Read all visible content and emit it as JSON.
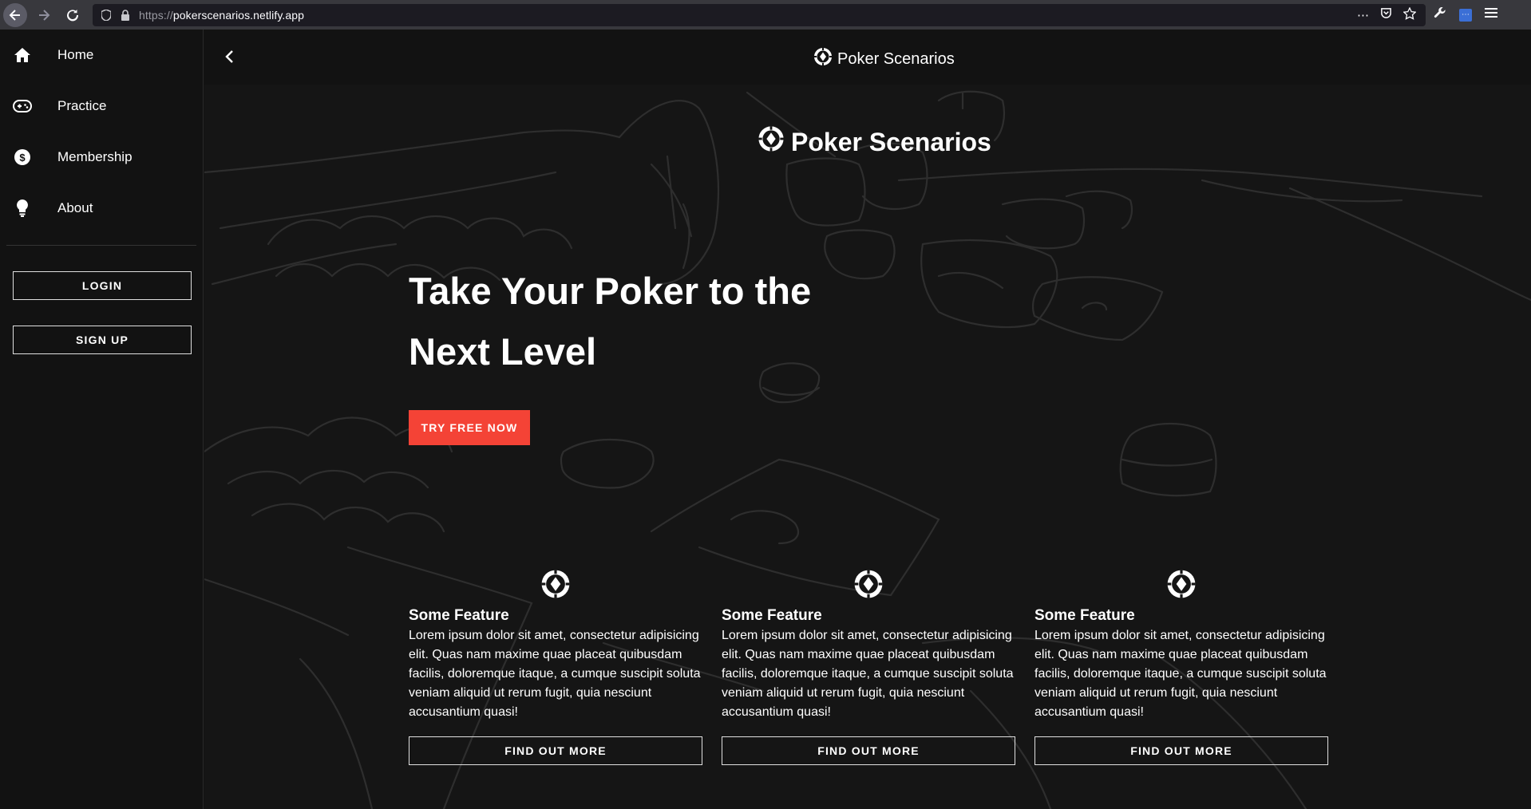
{
  "browser": {
    "url_scheme": "https://",
    "url_host": "pokerscenarios.netlify.app"
  },
  "sidebar": {
    "items": [
      {
        "label": "Home",
        "icon": "home-icon"
      },
      {
        "label": "Practice",
        "icon": "gamepad-icon"
      },
      {
        "label": "Membership",
        "icon": "dollar-icon"
      },
      {
        "label": "About",
        "icon": "lightbulb-icon"
      }
    ],
    "login_label": "LOGIN",
    "signup_label": "SIGN UP"
  },
  "topbar": {
    "title": "Poker Scenarios"
  },
  "hero": {
    "logo_text": "Poker Scenarios",
    "heading": "Take Your Poker to the Next Level",
    "cta_label": "TRY FREE NOW"
  },
  "features": [
    {
      "title": "Some Feature",
      "body": "Lorem ipsum dolor sit amet, consectetur adipisicing elit. Quas nam maxime quae placeat quibusdam facilis, doloremque itaque, a cumque suscipit soluta veniam aliquid ut rerum fugit, quia nesciunt accusantium quasi!",
      "button": "FIND OUT MORE"
    },
    {
      "title": "Some Feature",
      "body": "Lorem ipsum dolor sit amet, consectetur adipisicing elit. Quas nam maxime quae placeat quibusdam facilis, doloremque itaque, a cumque suscipit soluta veniam aliquid ut rerum fugit, quia nesciunt accusantium quasi!",
      "button": "FIND OUT MORE"
    },
    {
      "title": "Some Feature",
      "body": "Lorem ipsum dolor sit amet, consectetur adipisicing elit. Quas nam maxime quae placeat quibusdam facilis, doloremque itaque, a cumque suscipit soluta veniam aliquid ut rerum fugit, quia nesciunt accusantium quasi!",
      "button": "FIND OUT MORE"
    }
  ],
  "colors": {
    "accent": "#f44336",
    "background": "#151515",
    "sidebar": "#121212"
  }
}
